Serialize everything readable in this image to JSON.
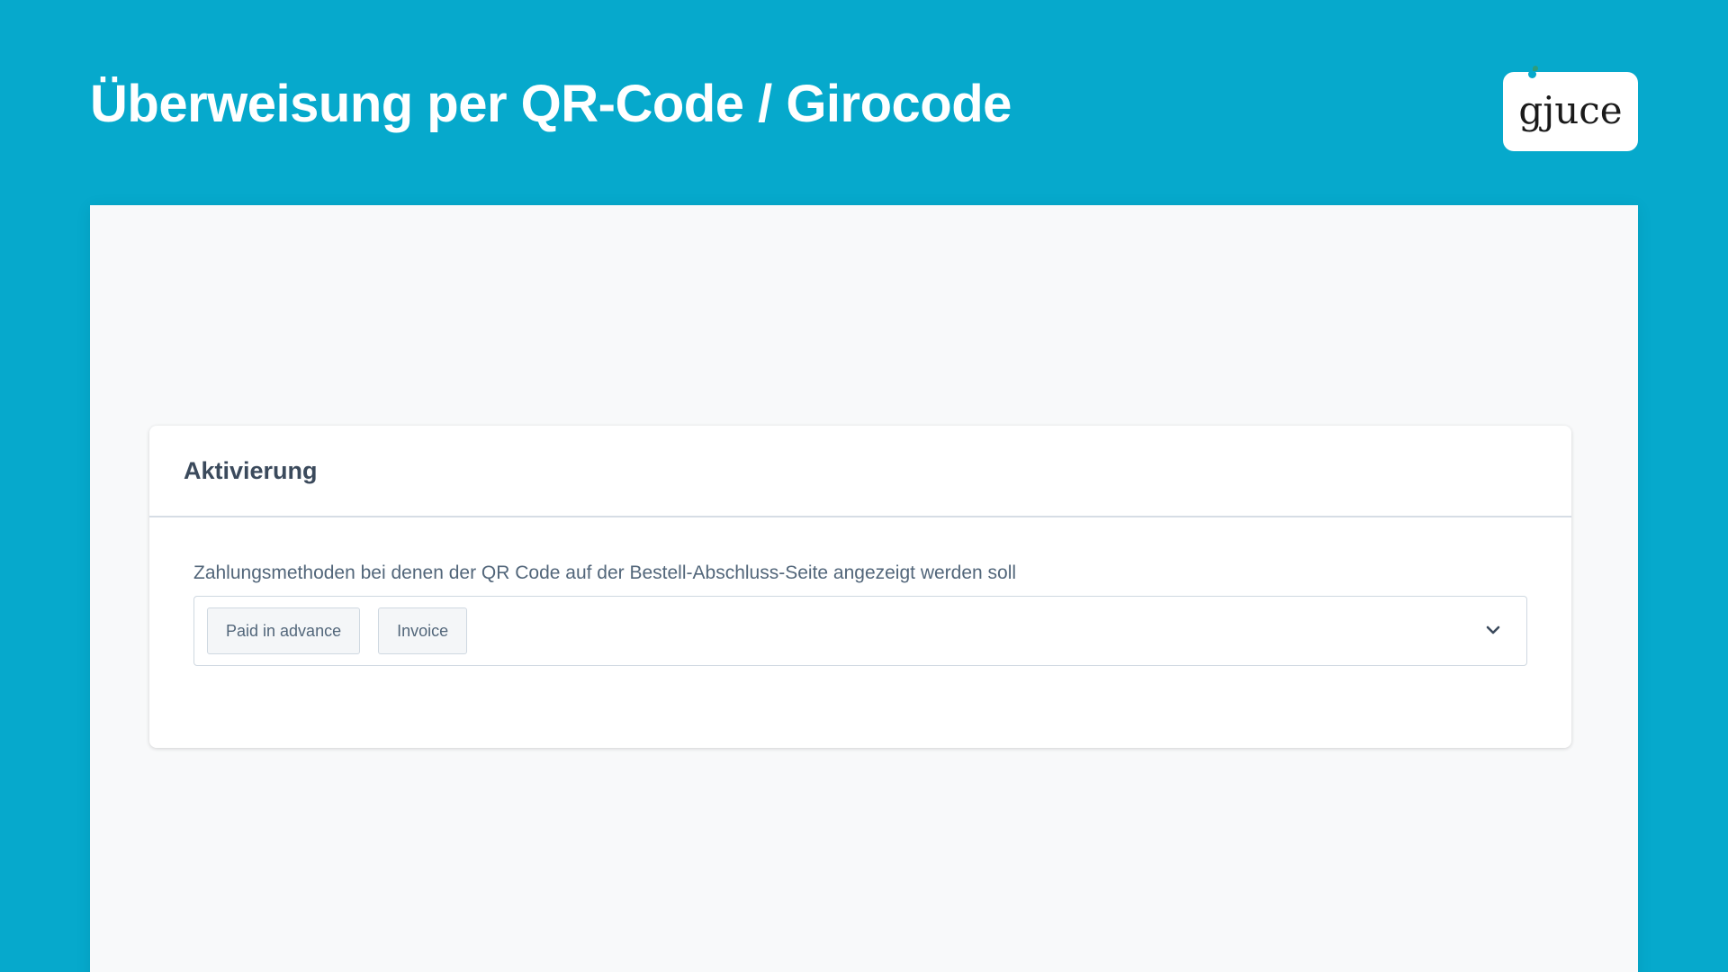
{
  "header": {
    "title": "Überweisung per QR-Code / Girocode",
    "logo_text": "gjuce",
    "logo_icon": "gjuce-logo-icon"
  },
  "card": {
    "title": "Aktivierung",
    "field_label": "Zahlungsmethoden bei denen der QR Code auf der Bestell-Abschluss-Seite angezeigt werden soll",
    "selected_tags": [
      {
        "label": "Paid in advance"
      },
      {
        "label": "Invoice"
      }
    ],
    "dropdown_icon": "chevron-down-icon"
  },
  "colors": {
    "background": "#06a9cc",
    "panel": "#f8f9fa",
    "card": "#ffffff",
    "text_primary": "#3b4a5c",
    "text_secondary": "#52667a",
    "border": "#cfd8e1"
  }
}
